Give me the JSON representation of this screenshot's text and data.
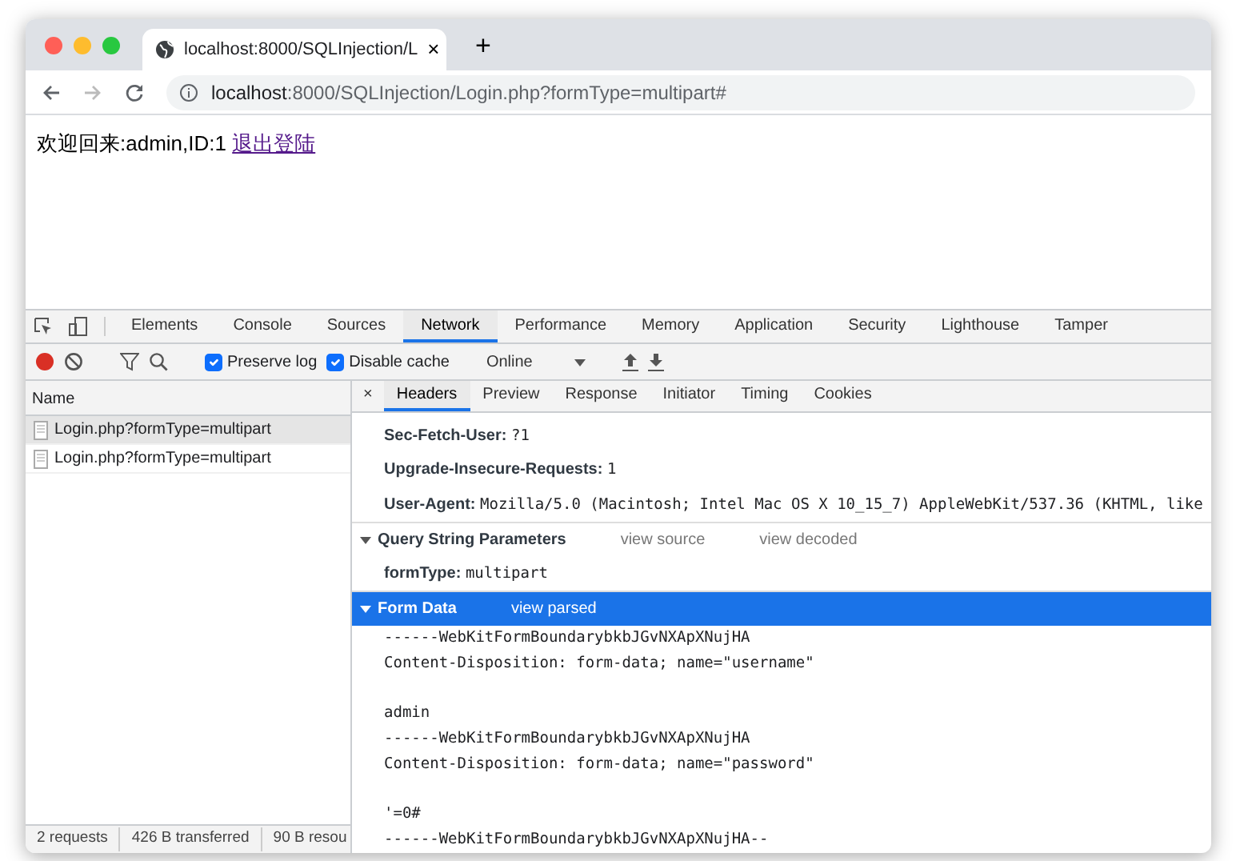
{
  "browser_tab": {
    "title": "localhost:8000/SQLInjection/L",
    "close": "×"
  },
  "new_tab": "+",
  "address_bar": {
    "host": "localhost",
    "rest": ":8000/SQLInjection/Login.php?formType=multipart#"
  },
  "page": {
    "greeting": "欢迎回来:admin,ID:1",
    "logout_link": "退出登陆"
  },
  "devtools_tabs": [
    {
      "label": "Elements",
      "selected": false
    },
    {
      "label": "Console",
      "selected": false
    },
    {
      "label": "Sources",
      "selected": false
    },
    {
      "label": "Network",
      "selected": true
    },
    {
      "label": "Performance",
      "selected": false
    },
    {
      "label": "Memory",
      "selected": false
    },
    {
      "label": "Application",
      "selected": false
    },
    {
      "label": "Security",
      "selected": false
    },
    {
      "label": "Lighthouse",
      "selected": false
    },
    {
      "label": "Tamper",
      "selected": false
    }
  ],
  "network_toolbar": {
    "recording": true,
    "checkboxes": [
      {
        "label": "Preserve log",
        "checked": true
      },
      {
        "label": "Disable cache",
        "checked": true
      }
    ],
    "throttling": "Online"
  },
  "requests": {
    "column": "Name",
    "rows": [
      {
        "name": "Login.php?formType=multipart",
        "selected": true
      },
      {
        "name": "Login.php?formType=multipart",
        "selected": false
      }
    ]
  },
  "detail_close": "×",
  "detail_tabs": [
    {
      "label": "Headers",
      "selected": true
    },
    {
      "label": "Preview",
      "selected": false
    },
    {
      "label": "Response",
      "selected": false
    },
    {
      "label": "Initiator",
      "selected": false
    },
    {
      "label": "Timing",
      "selected": false
    },
    {
      "label": "Cookies",
      "selected": false
    }
  ],
  "request_headers": [
    {
      "key": "Sec-Fetch-User:",
      "value": "?1"
    },
    {
      "key": "Upgrade-Insecure-Requests:",
      "value": "1"
    },
    {
      "key": "User-Agent:",
      "value": "Mozilla/5.0 (Macintosh; Intel Mac OS X 10_15_7) AppleWebKit/537.36 (KHTML, like"
    }
  ],
  "query_string": {
    "title": "Query String Parameters",
    "expanded": true,
    "links": [
      "view source",
      "view decoded"
    ],
    "params": [
      {
        "key": "formType:",
        "value": "multipart"
      }
    ]
  },
  "form_data": {
    "title": "Form Data",
    "expanded": true,
    "selected": true,
    "links": [
      "view parsed"
    ],
    "lines": [
      {
        "text": "------WebKitFormBoundarybkbJGvNXApXNujHA",
        "spaced": false
      },
      {
        "text": "Content-Disposition: form-data; name=\"username\"",
        "spaced": false
      },
      {
        "text": "admin",
        "spaced": true
      },
      {
        "text": "------WebKitFormBoundarybkbJGvNXApXNujHA",
        "spaced": false
      },
      {
        "text": "Content-Disposition: form-data; name=\"password\"",
        "spaced": false
      },
      {
        "text": "'=0#",
        "spaced": true
      },
      {
        "text": "------WebKitFormBoundarybkbJGvNXApXNujHA--",
        "spaced": false
      }
    ]
  },
  "status_bar": [
    "2 requests",
    "426 B transferred",
    "90 B resou"
  ]
}
